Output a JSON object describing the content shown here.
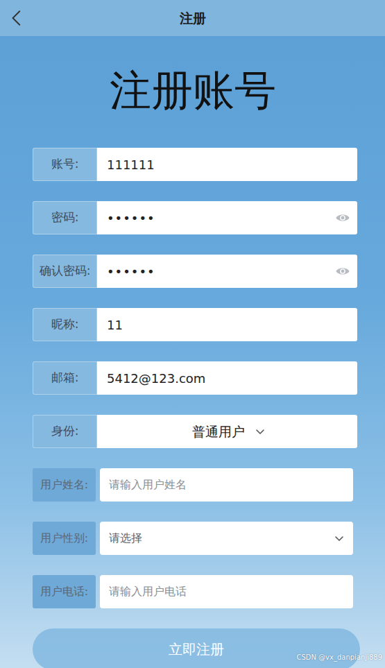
{
  "top_bar": {
    "title": "注册"
  },
  "heading": "注册账号",
  "fields": [
    {
      "label": "账号:",
      "kind": "text",
      "value": "111111"
    },
    {
      "label": "密码:",
      "kind": "password",
      "value": "••••••"
    },
    {
      "label": "确认密码:",
      "kind": "password",
      "value": "••••••"
    },
    {
      "label": "昵称:",
      "kind": "text",
      "value": "11"
    },
    {
      "label": "邮箱:",
      "kind": "text",
      "value": "5412@123.com"
    },
    {
      "label": "身份:",
      "kind": "select",
      "value": "普通用户"
    }
  ],
  "profile_fields": [
    {
      "label": "用户姓名:",
      "kind": "text",
      "placeholder": "请输入用户姓名"
    },
    {
      "label": "用户性别:",
      "kind": "select",
      "placeholder": "请选择"
    },
    {
      "label": "用户电话:",
      "kind": "text",
      "placeholder": "请输入用户电话"
    }
  ],
  "submit": "立即注册",
  "watermark": "CSDN @vx_danpianji889"
}
